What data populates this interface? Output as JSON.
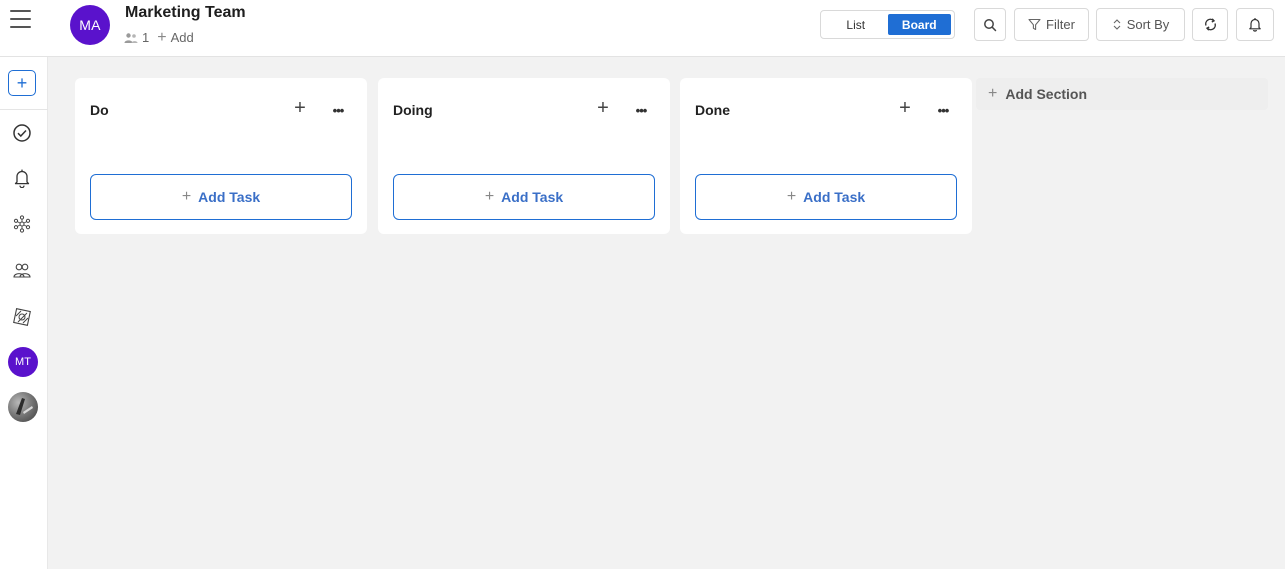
{
  "header": {
    "team_avatar_initials": "MA",
    "team_name": "Marketing Team",
    "member_count": "1",
    "add_member_label": "Add",
    "view_options": [
      "List",
      "Board"
    ],
    "active_view": "Board",
    "filter_label": "Filter",
    "sort_label": "Sort By",
    "icons": {
      "menu": "hamburger-menu-icon",
      "members": "members-icon",
      "search": "search-icon",
      "filter": "filter-icon",
      "sort": "sort-icon",
      "refresh": "refresh-icon",
      "notifications": "bell-icon"
    }
  },
  "sidebar": {
    "add_label": "+",
    "items": [
      {
        "icon": "check-circle-icon"
      },
      {
        "icon": "bell-icon"
      },
      {
        "icon": "network-icon"
      },
      {
        "icon": "team-icon"
      },
      {
        "icon": "cube-icon"
      }
    ],
    "avatar_initials": "MT"
  },
  "board": {
    "sections": [
      {
        "title": "Do",
        "add_task_label": "Add Task"
      },
      {
        "title": "Doing",
        "add_task_label": "Add Task"
      },
      {
        "title": "Done",
        "add_task_label": "Add Task"
      }
    ],
    "add_section_label": "Add Section"
  },
  "colors": {
    "accent": "#1f6ed4",
    "avatar_purple": "#5a12cc",
    "board_bg": "#f2f2f2"
  }
}
